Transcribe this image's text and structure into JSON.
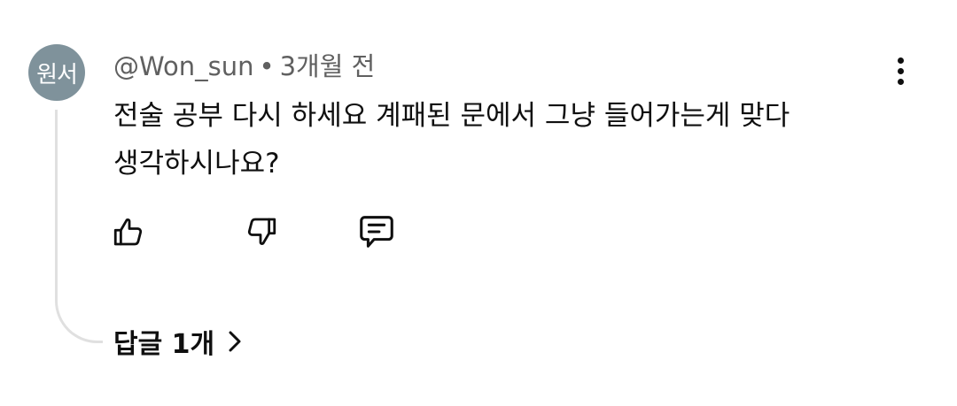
{
  "comment": {
    "avatar_text": "원서",
    "avatar_color": "#7f929b",
    "author": "@Won_sun",
    "separator": "•",
    "timestamp": "3개월 전",
    "text_line1": "전술 공부 다시 하세요 계패된 문에서 그냥 들어가는게 맞다",
    "text_line2": "생각하시나요?"
  },
  "actions": {
    "like_icon": "thumbs-up-icon",
    "dislike_icon": "thumbs-down-icon",
    "reply_icon": "comment-icon",
    "more_icon": "more-vertical-icon"
  },
  "replies": {
    "label": "답글 1개",
    "chevron_icon": "chevron-right-icon"
  }
}
